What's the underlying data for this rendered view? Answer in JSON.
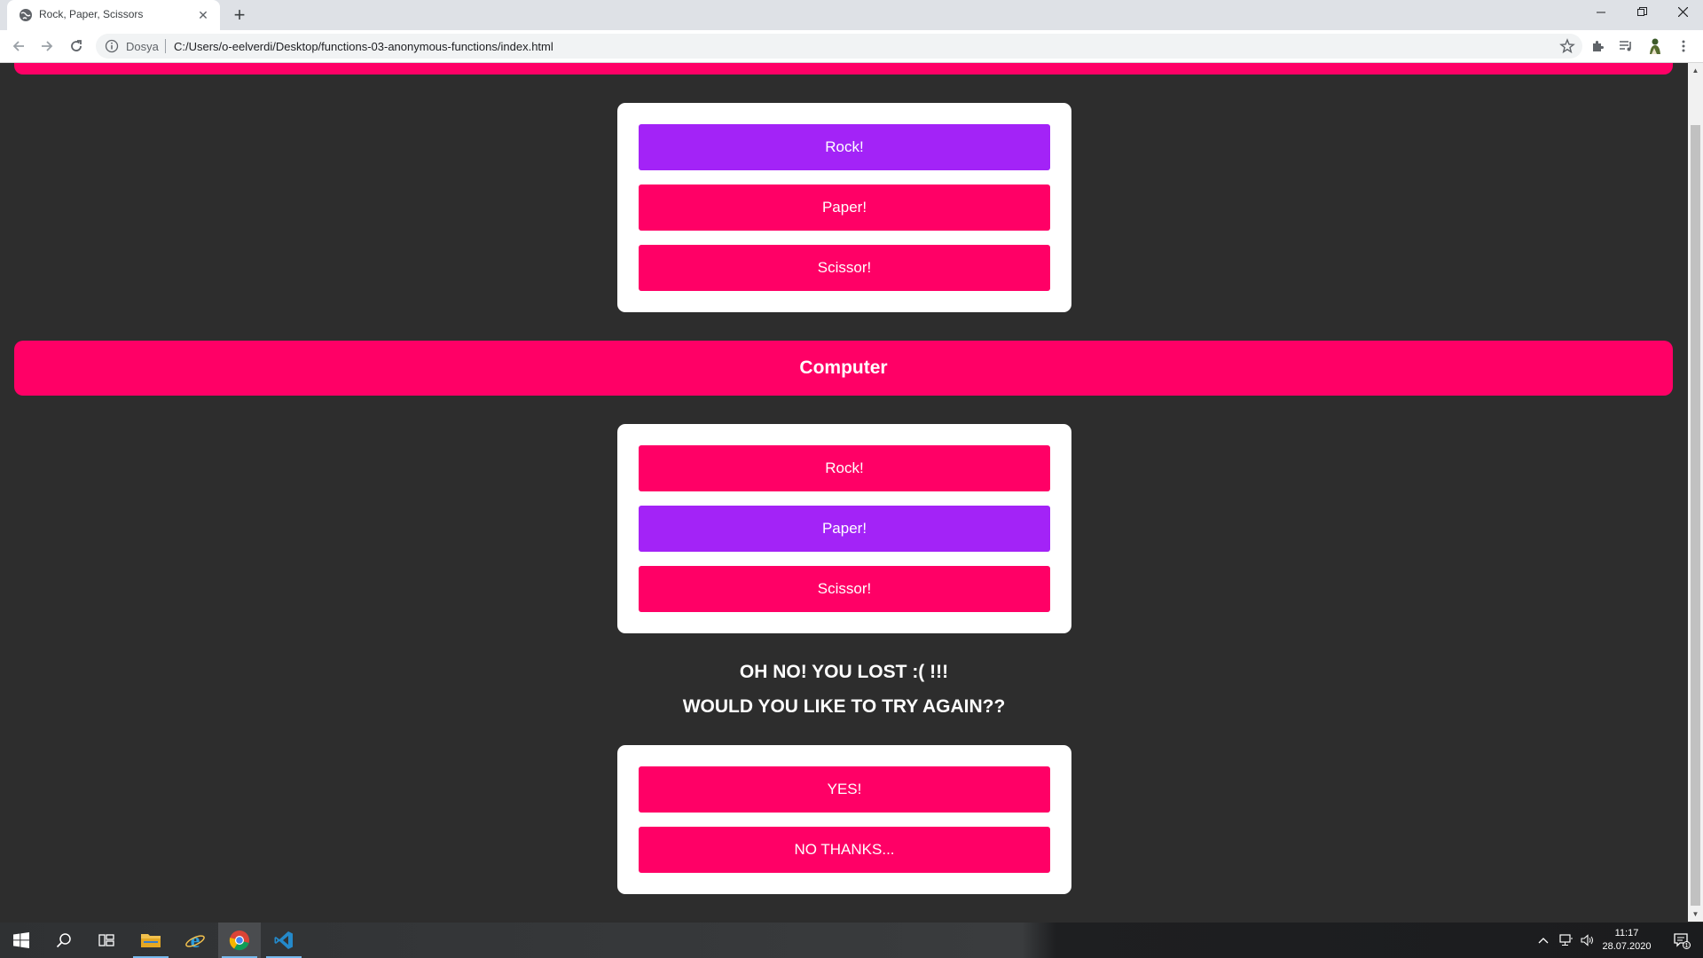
{
  "browser": {
    "tab_title": "Rock, Paper, Scissors",
    "tab_close": "✕",
    "new_tab": "+",
    "scheme_label": "Dosya",
    "url": "C:/Users/o-eelverdi/Desktop/functions-03-anonymous-functions/index.html"
  },
  "player_choices": {
    "rock": "Rock!",
    "paper": "Paper!",
    "scissor": "Scissor!",
    "selected": "rock"
  },
  "computer": {
    "banner": "Computer",
    "rock": "Rock!",
    "paper": "Paper!",
    "scissor": "Scissor!",
    "selected": "paper"
  },
  "result": {
    "line1": "OH NO! YOU LOST :( !!!",
    "line2": "WOULD YOU LIKE TO TRY AGAIN??"
  },
  "retry": {
    "yes": "YES!",
    "no": "NO THANKS..."
  },
  "colors": {
    "accent": "#ff0066",
    "selected": "#a323f7",
    "page_bg": "#2d2d2d"
  },
  "taskbar": {
    "time": "11:17",
    "date": "28.07.2020",
    "notification_count": "1"
  }
}
